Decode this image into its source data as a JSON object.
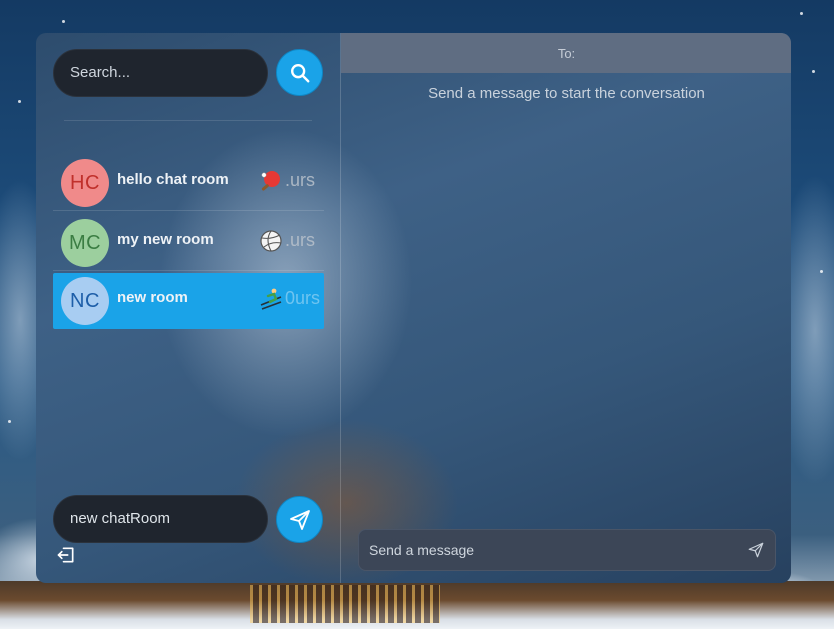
{
  "sidebar": {
    "search": {
      "placeholder": "Search..."
    },
    "rooms": [
      {
        "initials": "HC",
        "name": "hello chat room",
        "emoji": "ping-pong-icon",
        "time": ".urs",
        "avatar_bg": "#f08a8a",
        "avatar_fg": "#c0302b",
        "active": false
      },
      {
        "initials": "MC",
        "name": "my new room",
        "emoji": "volleyball-icon",
        "time": ".urs",
        "avatar_bg": "#9ccf9e",
        "avatar_fg": "#3b7d43",
        "active": false
      },
      {
        "initials": "NC",
        "name": "new room",
        "emoji": "skiing-icon",
        "time": "0urs",
        "avatar_bg": "#a8cdf2",
        "avatar_fg": "#1d5ea8",
        "active": true
      }
    ],
    "new_room": {
      "value": "new chatRoom"
    }
  },
  "chat": {
    "header_label": "To:",
    "empty_hint": "Send a message to start the conversation",
    "message_placeholder": "Send a message"
  },
  "colors": {
    "accent": "#1aa3e8",
    "input_bg": "#1f252e",
    "header_bg": "#5f6d82"
  }
}
